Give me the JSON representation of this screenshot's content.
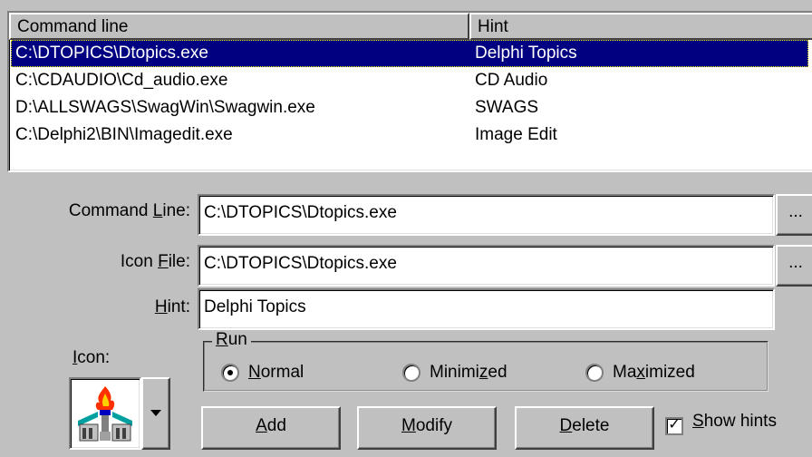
{
  "list": {
    "columns": [
      "Command line",
      "Hint"
    ],
    "rows": [
      {
        "command": "C:\\DTOPICS\\Dtopics.exe",
        "hint": "Delphi Topics",
        "selected": true
      },
      {
        "command": "C:\\CDAUDIO\\Cd_audio.exe",
        "hint": "CD Audio"
      },
      {
        "command": "D:\\ALLSWAGS\\SwagWin\\Swagwin.exe",
        "hint": "SWAGS"
      },
      {
        "command": "C:\\Delphi2\\BIN\\Imagedit.exe",
        "hint": "Image Edit"
      }
    ]
  },
  "form": {
    "command_line_label_a": "Command ",
    "command_line_label_u": "L",
    "command_line_label_b": "ine:",
    "command_line_value": "C:\\DTOPICS\\Dtopics.exe",
    "icon_file_label_a": "Icon ",
    "icon_file_label_u": "F",
    "icon_file_label_b": "ile:",
    "icon_file_value": "C:\\DTOPICS\\Dtopics.exe",
    "hint_label_u": "H",
    "hint_label_b": "int:",
    "hint_value": "Delphi Topics",
    "icon_label_u": "I",
    "icon_label_b": "con:",
    "browse_label": "..."
  },
  "run": {
    "legend_u": "R",
    "legend_b": "un",
    "options": [
      {
        "a": "",
        "u": "N",
        "b": "ormal",
        "selected": true
      },
      {
        "a": "Minimi",
        "u": "z",
        "b": "ed",
        "selected": false
      },
      {
        "a": "Ma",
        "u": "x",
        "b": "imized",
        "selected": false
      }
    ]
  },
  "buttons": {
    "add_u": "A",
    "add_b": "dd",
    "modify_u": "M",
    "modify_b": "odify",
    "delete_u": "D",
    "delete_b": "elete"
  },
  "show_hints": {
    "a": "",
    "u": "S",
    "b": "how hints",
    "checked": true,
    "check_glyph": "✓"
  },
  "icons": {
    "program_icon": "torch-building-icon",
    "dropdown": "triangle-down-icon"
  }
}
